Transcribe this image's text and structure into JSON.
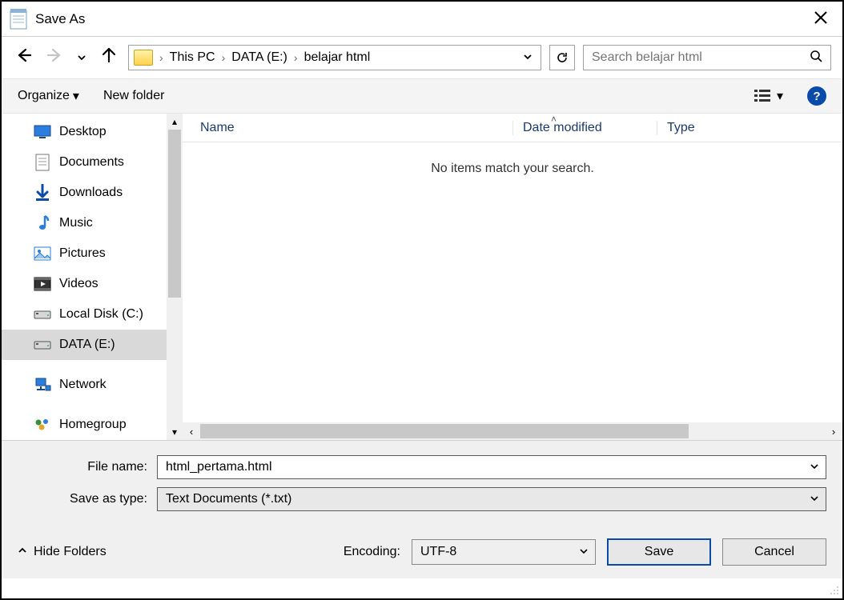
{
  "window": {
    "title": "Save As"
  },
  "nav": {
    "breadcrumbs": [
      "This PC",
      "DATA (E:)",
      "belajar html"
    ],
    "search_placeholder": "Search belajar html"
  },
  "toolbar": {
    "organize": "Organize",
    "newfolder": "New folder"
  },
  "sidebar": {
    "items": [
      {
        "label": "Desktop",
        "icon": "desktop"
      },
      {
        "label": "Documents",
        "icon": "document"
      },
      {
        "label": "Downloads",
        "icon": "download"
      },
      {
        "label": "Music",
        "icon": "music"
      },
      {
        "label": "Pictures",
        "icon": "pictures"
      },
      {
        "label": "Videos",
        "icon": "videos"
      },
      {
        "label": "Local Disk (C:)",
        "icon": "disk"
      },
      {
        "label": "DATA (E:)",
        "icon": "disk",
        "selected": true
      },
      {
        "label": "Network",
        "icon": "network",
        "gap": true
      },
      {
        "label": "Homegroup",
        "icon": "homegroup",
        "gap": true
      }
    ]
  },
  "columns": {
    "name": "Name",
    "date": "Date modified",
    "type": "Type"
  },
  "empty_text": "No items match your search.",
  "form": {
    "filename_label": "File name:",
    "filename_value": "html_pertama.html",
    "savetype_label": "Save as type:",
    "savetype_value": "Text Documents (*.txt)"
  },
  "footer": {
    "hide_folders": "Hide Folders",
    "encoding_label": "Encoding:",
    "encoding_value": "UTF-8",
    "save": "Save",
    "cancel": "Cancel"
  }
}
